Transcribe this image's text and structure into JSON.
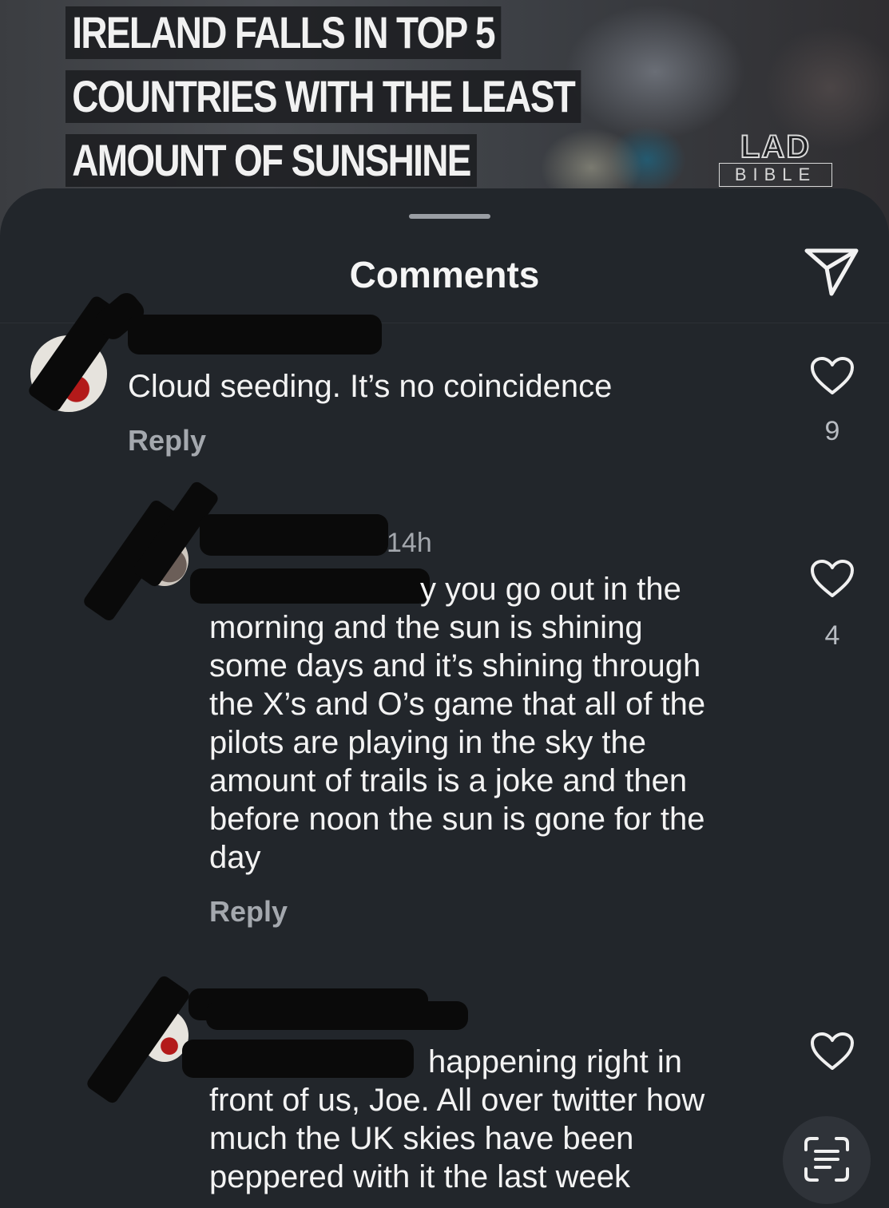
{
  "banner": {
    "headline_lines": [
      "IRELAND FALLS IN TOP 5",
      "COUNTRIES WITH THE LEAST",
      "AMOUNT OF SUNSHINE"
    ],
    "logo_top": "LAD",
    "logo_bottom": "BIBLE"
  },
  "sheet": {
    "title": "Comments",
    "send_icon": "paper-plane-icon"
  },
  "comments": [
    {
      "text": "Cloud seeding. It’s no coincidence",
      "reply_label": "Reply",
      "like_count": "9",
      "like_icon": "heart-outline-icon"
    },
    {
      "time": "14h",
      "first_line_visible": "y you go out in the",
      "text": "morning and the sun is shining\nsome days and it’s shining through\nthe X’s and O’s game that all of the\npilots are playing in the sky the\namount of trails is a joke and then\nbefore noon the sun is gone for the\nday",
      "reply_label": "Reply",
      "like_count": "4",
      "like_icon": "heart-outline-icon"
    },
    {
      "first_line_visible": "happening right in",
      "text": "front of us, Joe. All over twitter how\nmuch the UK skies have been\npeppered with it the last week",
      "like_icon": "heart-outline-icon"
    }
  ],
  "floating_button": {
    "icon": "text-scan-icon"
  },
  "colors": {
    "background": "#22262b",
    "text": "#f3f3f3",
    "muted": "#a4a8ae"
  }
}
